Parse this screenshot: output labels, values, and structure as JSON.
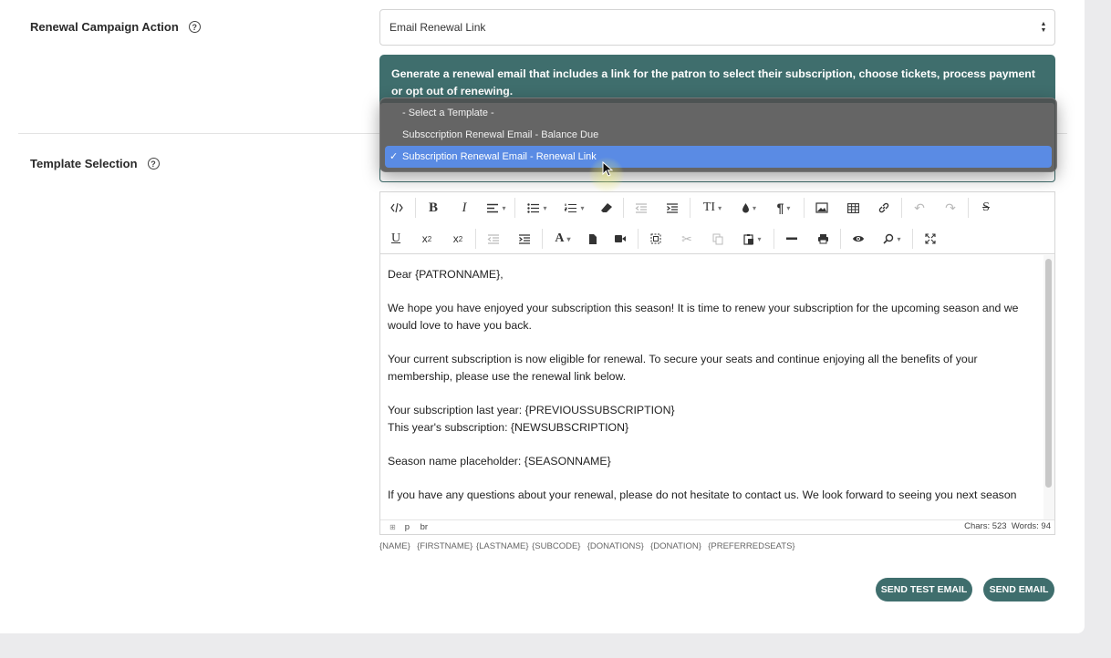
{
  "campaign": {
    "label": "Renewal Campaign Action",
    "help": "?",
    "selected_value": "Email Renewal Link",
    "info": "Generate a renewal email that includes a link for the patron to select their subscription, choose tickets, process payment or opt out of renewing."
  },
  "template": {
    "label": "Template Selection",
    "help": "?",
    "options": [
      "- Select a Template -",
      "Subsccription Renewal Email - Balance Due",
      "Subscription Renewal Email - Renewal Link"
    ],
    "selected_index": 2,
    "check": "✓"
  },
  "toolbar": {
    "row1": [
      "code-view-icon",
      "bold-icon",
      "italic-icon",
      "align-icon",
      "bullet-list-icon",
      "numbered-list-icon",
      "eraser-icon",
      "outdent-icon",
      "indent-icon",
      "font-size-icon",
      "color-drop-icon",
      "paragraph-icon",
      "image-icon",
      "table-icon",
      "link-icon",
      "undo-icon",
      "redo-icon",
      "strikethrough-icon"
    ],
    "row2": [
      "underline-icon",
      "superscript-icon",
      "subscript-icon",
      "outdent-icon",
      "indent-icon",
      "font-color-icon",
      "file-icon",
      "video-icon",
      "select-all-icon",
      "cut-icon",
      "copy-icon",
      "paste-icon",
      "horizontal-rule-icon",
      "print-icon",
      "preview-icon",
      "search-icon",
      "fullscreen-icon"
    ]
  },
  "editor": {
    "paragraphs": [
      "Dear {PATRONNAME},",
      "We hope you have enjoyed your subscription this season! It is time to renew your subscription for the upcoming season and we would love to have you back.",
      "Your current subscription is now eligible for renewal. To secure your seats and continue enjoying all the benefits of your membership, please use the renewal link below.",
      "Your subscription last year: {PREVIOUSSUBSCRIPTION}",
      "This year's subscription: {NEWSUBSCRIPTION}",
      "Season name placeholder: {SEASONNAME}",
      "If you have any questions about your renewal, please do not hesitate to contact us. We look forward to seeing you next season"
    ],
    "status_path": [
      "p",
      "br"
    ],
    "status_counts": "Chars: 523  Words: 94"
  },
  "tags": "{NAME}  {FIRSTNAME} {LASTNAME} {SUBCODE}  {DONATIONS}  {DONATION}  {PREFERREDSEATS}",
  "actions": {
    "send_test": "SEND TEST EMAIL",
    "send": "SEND EMAIL"
  },
  "colors": {
    "accent": "#3f6e6d",
    "selection": "#5a8be4"
  }
}
